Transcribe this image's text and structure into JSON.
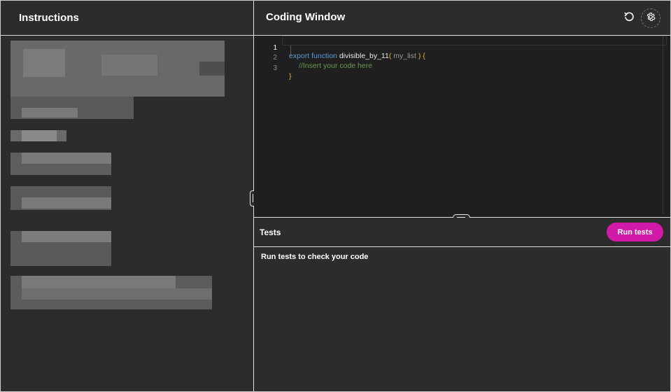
{
  "instructions": {
    "title": "Instructions"
  },
  "coding": {
    "title": "Coding Window",
    "reset_icon": "reset-icon",
    "settings_icon": "gear-icon",
    "lines": [
      {
        "num": "1",
        "kw": "export function",
        "fn": "divisible_by_11",
        "open": "(",
        "param": " my_list ",
        "close": ") {"
      },
      {
        "num": "2",
        "comment": "//Insert your code here"
      },
      {
        "num": "3",
        "brace": "}"
      }
    ]
  },
  "tests": {
    "title": "Tests",
    "run_label": "Run tests",
    "message": "Run tests to check your code",
    "accent": "#d21aa8"
  }
}
